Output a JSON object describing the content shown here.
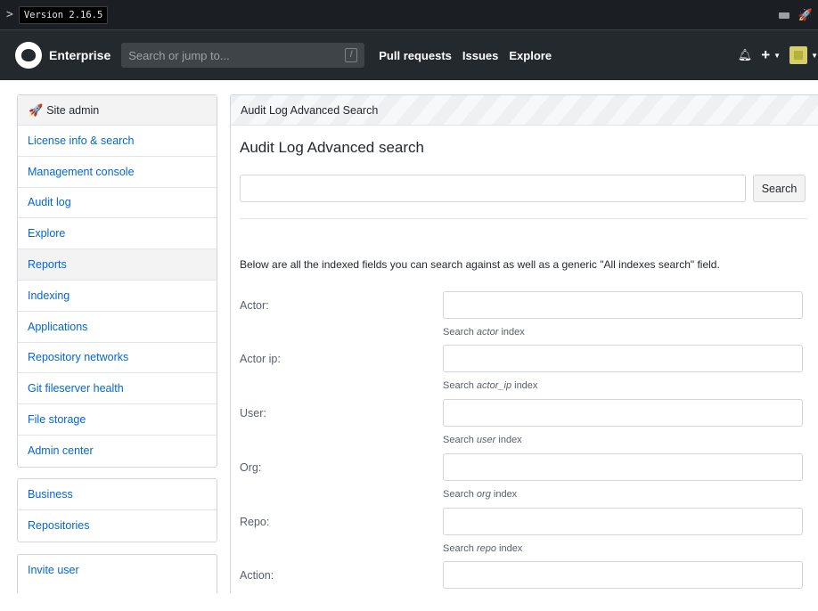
{
  "topbar": {
    "version": "Version 2.16.5"
  },
  "header": {
    "brand": "Enterprise",
    "search_placeholder": "Search or jump to...",
    "search_key": "/",
    "nav": [
      "Pull requests",
      "Issues",
      "Explore"
    ]
  },
  "sidebar": {
    "title": "Site admin",
    "items": [
      "License info & search",
      "Management console",
      "Audit log",
      "Explore",
      "Reports",
      "Indexing",
      "Applications",
      "Repository networks",
      "Git fileserver health",
      "File storage",
      "Admin center"
    ],
    "selected_item": "Reports",
    "group2": [
      "Business",
      "Repositories"
    ],
    "group3": [
      "Invite user"
    ]
  },
  "main": {
    "panel_header": "Audit Log Advanced Search",
    "title": "Audit Log Advanced search",
    "search_button": "Search",
    "description": "Below are all the indexed fields you can search against as well as a generic \"All indexes search\" field.",
    "fields": [
      {
        "label": "Actor:",
        "help_prefix": "Search ",
        "help_field": "actor",
        "help_suffix": " index"
      },
      {
        "label": "Actor ip:",
        "help_prefix": "Search ",
        "help_field": "actor_ip",
        "help_suffix": " index"
      },
      {
        "label": "User:",
        "help_prefix": "Search ",
        "help_field": "user",
        "help_suffix": " index"
      },
      {
        "label": "Org:",
        "help_prefix": "Search ",
        "help_field": "org",
        "help_suffix": " index"
      },
      {
        "label": "Repo:",
        "help_prefix": "Search ",
        "help_field": "repo",
        "help_suffix": " index"
      },
      {
        "label": "Action:",
        "help_prefix": "",
        "help_field": "",
        "help_suffix": ""
      }
    ]
  }
}
